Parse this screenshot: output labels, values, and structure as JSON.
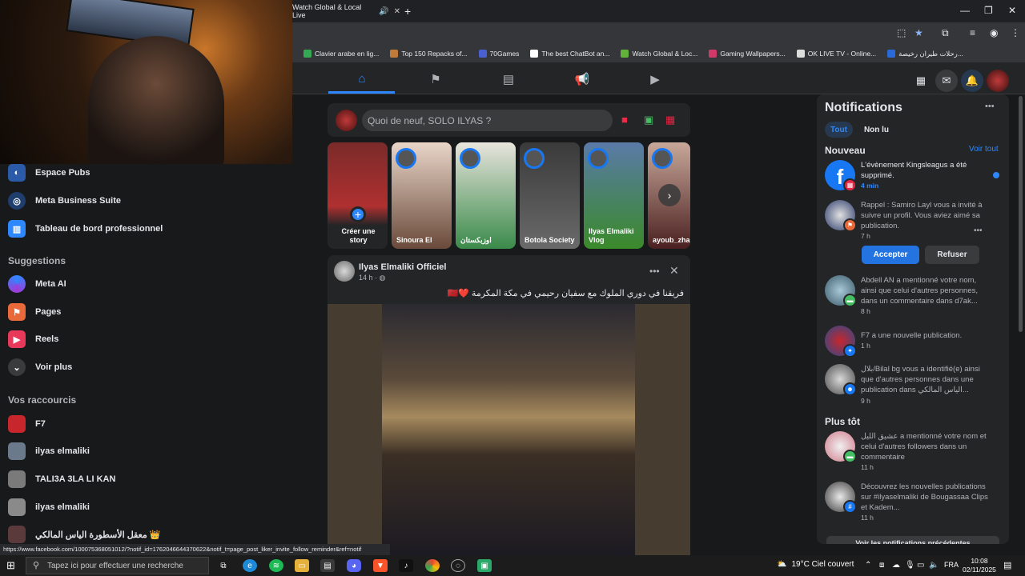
{
  "browser": {
    "tab_title": "Watch Global & Local Live",
    "bookmarks": [
      "Clavier arabe en lig...",
      "Top 150 Repacks of...",
      "70Games",
      "The best ChatBot an...",
      "Watch Global & Loc...",
      "Gaming Wallpapers...",
      "OK LIVE TV - Online...",
      "رحلات طيران رخيصة..."
    ],
    "status_url": "https://www.facebook.com/100075368051012/?notif_id=1762046644370622&notif_t=page_post_liker_invite_follow_reminder&ref=notif"
  },
  "sidebar": {
    "items_top": [
      "Espace Pubs",
      "Meta Business Suite",
      "Tableau de bord professionnel"
    ],
    "suggestions_heading": "Suggestions",
    "suggestions": [
      "Meta AI",
      "Pages",
      "Reels",
      "Voir plus"
    ],
    "shortcuts_heading": "Vos raccourcis",
    "shortcuts": [
      "F7",
      "ilyas elmaliki",
      "TALI3A 3LA LI KAN",
      "ilyas elmaliki",
      "معقل الأسطورة الياس المالكي 👑"
    ]
  },
  "composer": {
    "placeholder": "Quoi de neuf, SOLO ILYAS ?"
  },
  "stories": [
    {
      "label": "Créer une story"
    },
    {
      "label": "Sinoura El"
    },
    {
      "label": "اوزبكستان"
    },
    {
      "label": "Botola Society"
    },
    {
      "label": "Ilyas Elmaliki Vlog"
    },
    {
      "label": "ayoub_zha"
    }
  ],
  "post": {
    "author": "Ilyas Elmaliki Officiel",
    "time": "14 h · ",
    "caption": "فريقنا في دوري الملوك مع سفيان رحيمي في مكة المكرمة ❤️🇲🇦"
  },
  "notifications": {
    "title": "Notifications",
    "tabs": [
      "Tout",
      "Non lu"
    ],
    "new_heading": "Nouveau",
    "see_all": "Voir tout",
    "earlier_heading": "Plus tôt",
    "accept": "Accepter",
    "refuse": "Refuser",
    "more": "Voir les notifications précédentes",
    "items": [
      {
        "text": "L'évènement Kingsleagus a été supprimé.",
        "time": "4 min"
      },
      {
        "text": "Rappel : Samiro Layl vous a invité à suivre un profil. Vous aviez aimé sa publication.",
        "time": "7 h"
      },
      {
        "text": "Abdell AN a mentionné votre nom, ainsi que celui d'autres personnes, dans un commentaire dans d7ak...",
        "time": "8 h"
      },
      {
        "text": "F7 a une nouvelle publication.",
        "time": "1 h"
      },
      {
        "text": "بلال/Bilal bg vous a identifié(e) ainsi que d'autres personnes dans une publication dans الياس المالكي...",
        "time": "9 h"
      },
      {
        "text": "عشيق الليل a mentionné votre nom et celui d'autres followers dans un commentaire",
        "time": "11 h"
      },
      {
        "text": "Découvrez les nouvelles publications sur #ilyaselmaliki de Bougassaa Clips et Kadem...",
        "time": "11 h"
      }
    ]
  },
  "taskbar": {
    "search_placeholder": "Tapez ici pour effectuer une recherche",
    "weather": "19°C Ciel couvert",
    "lang": "FRA",
    "time": "10:08",
    "date": "02/11/2025"
  },
  "colors": {
    "accent": "#2d88ff",
    "bg": "#18191a",
    "card": "#242526"
  }
}
